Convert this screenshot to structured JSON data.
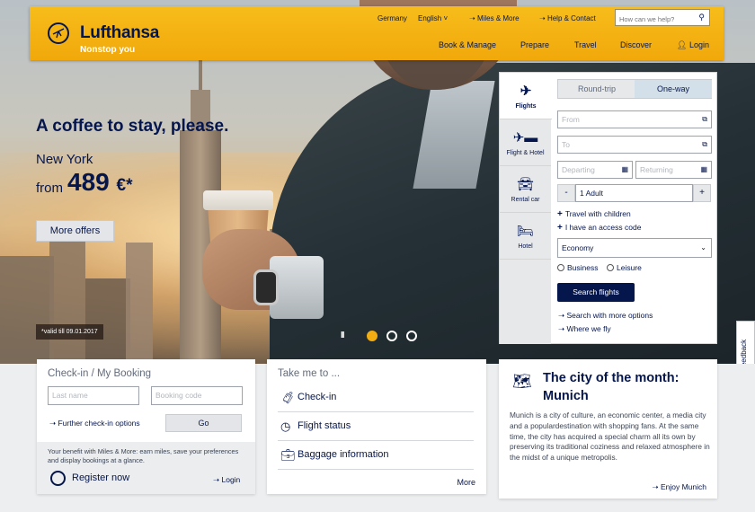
{
  "header": {
    "brand": "Lufthansa",
    "tagline": "Nonstop you",
    "top_links": {
      "country": "Germany",
      "language": "English ˅",
      "miles": "Miles & More",
      "help": "Help & Contact"
    },
    "search_placeholder": "How can we help?",
    "nav": {
      "book": "Book & Manage",
      "prepare": "Prepare",
      "travel": "Travel",
      "discover": "Discover",
      "login": "Login"
    }
  },
  "hero": {
    "title": "A coffee to stay, please.",
    "city": "New York",
    "from_label": "from",
    "price": "489",
    "currency": "€*",
    "more_offers": "More offers",
    "valid_note": "*valid till 09.01.2017",
    "pause_symbol": "II",
    "carousel": {
      "slides": 3,
      "active_slide": 1
    }
  },
  "widget": {
    "tabs": {
      "flights": "Flights",
      "flight_hotel": "Flight & Hotel",
      "rental": "Rental car",
      "hotel": "Hotel"
    },
    "trip_roundtrip": "Round-trip",
    "trip_oneway": "One-way",
    "from_placeholder": "From",
    "to_placeholder": "To",
    "departing_placeholder": "Departing",
    "returning_placeholder": "Returning",
    "minus": "-",
    "plus": "+",
    "passengers": "1 Adult",
    "travel_children": "Travel with children",
    "access_code": "I have an access code",
    "cabin_class": "Economy",
    "business": "Business",
    "leisure": "Leisure",
    "search_button": "Search flights",
    "more_options": "Search with more options",
    "where_we_fly": "Where we fly"
  },
  "feedback": "Website Feedback",
  "checkin_card": {
    "title": "Check-in / My Booking",
    "last_name_placeholder": "Last name",
    "booking_code_placeholder": "Booking code",
    "further_options": "Further check-in options",
    "go": "Go",
    "promo_text": "Your benefit with Miles & More: earn miles, save your preferences and display bookings at a glance.",
    "register": "Register now",
    "login": "Login"
  },
  "takeme_card": {
    "title": "Take me to ...",
    "checkin": "Check-in",
    "flight_status": "Flight status",
    "baggage": "Baggage information",
    "more": "More"
  },
  "city_card": {
    "title": "The city of the month: Munich",
    "text": "Munich is a city of culture, an economic center, a media city and a populardestination with shopping fans. At the same time, the city has acquired a special charm all its own by preserving its traditional coziness and relaxed atmosphere in the midst of a unique metropolis.",
    "enjoy": "Enjoy Munich"
  },
  "colors": {
    "brand_yellow": "#f2ad13",
    "navy": "#05164d"
  }
}
